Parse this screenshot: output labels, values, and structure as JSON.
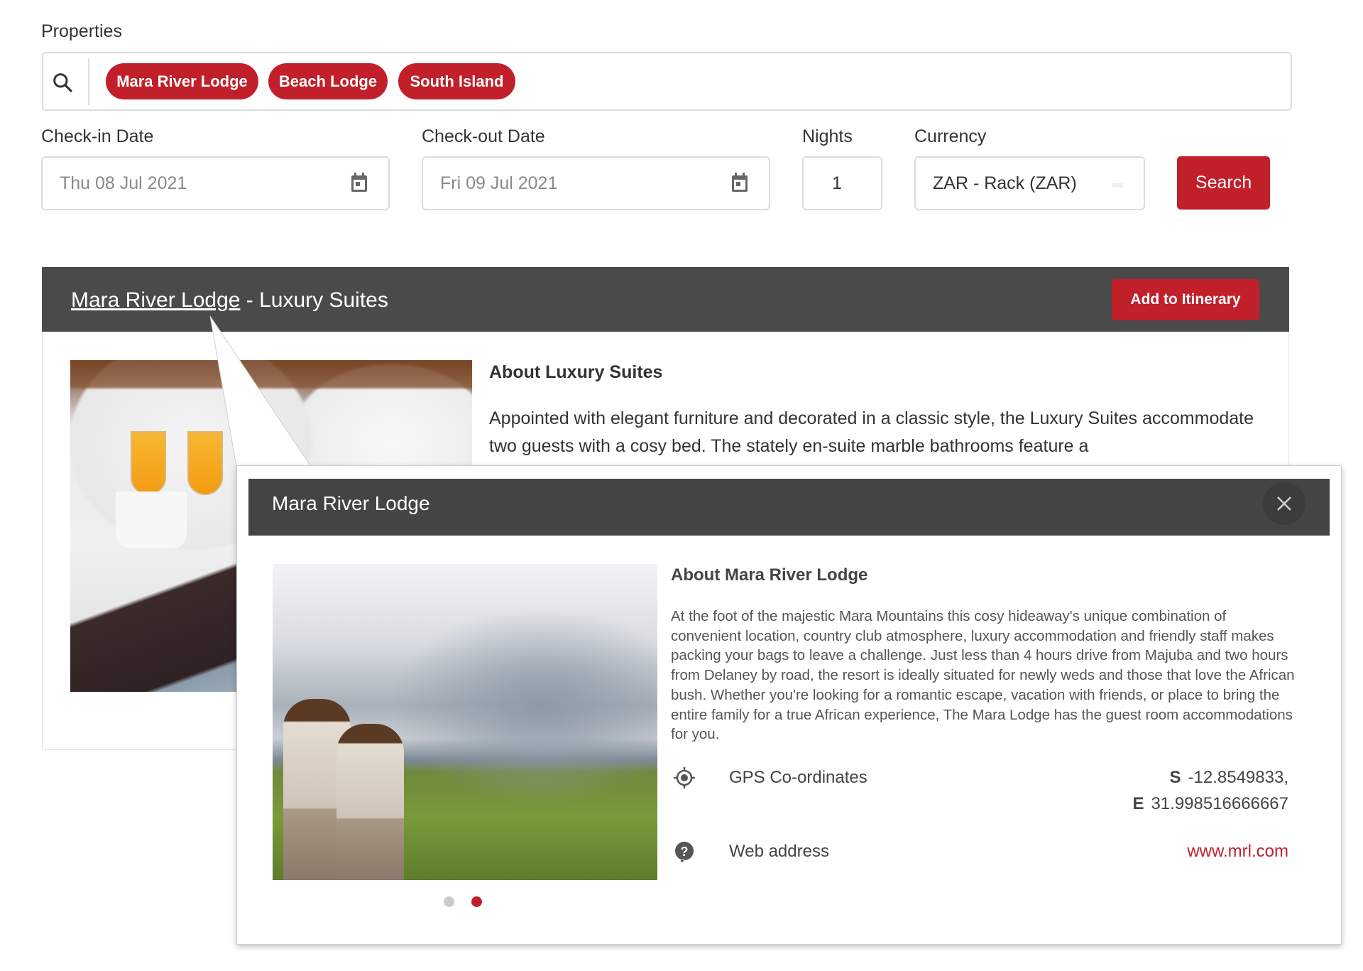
{
  "properties": {
    "label": "Properties",
    "search_icon": "search-icon",
    "chips": [
      {
        "label": "Mara River Lodge"
      },
      {
        "label": "Beach Lodge"
      },
      {
        "label": "South Island"
      }
    ]
  },
  "form": {
    "checkin": {
      "label": "Check-in Date",
      "value": "Thu 08 Jul 2021",
      "icon": "calendar-icon"
    },
    "checkout": {
      "label": "Check-out Date",
      "value": "Fri 09 Jul 2021",
      "icon": "calendar-icon"
    },
    "nights": {
      "label": "Nights",
      "value": "1"
    },
    "currency": {
      "label": "Currency",
      "value": "ZAR - Rack (ZAR)"
    },
    "search_button": "Search"
  },
  "room": {
    "property_link": "Mara River Lodge",
    "title_suffix": " - Luxury Suites",
    "add_button": "Add to Itinerary",
    "about_heading": "About Luxury Suites",
    "about_text": "Appointed with elegant furniture and decorated in a classic style, the Luxury Suites accommodate two guests with a cosy bed. The stately en-suite marble bathrooms feature a"
  },
  "popup": {
    "title": "Mara River Lodge",
    "close_icon": "close-icon",
    "about_heading": "About Mara River Lodge",
    "about_text": "At the foot of the majestic Mara Mountains this cosy hideaway's unique combination of convenient location, country club atmosphere, luxury accommodation and friendly staff makes packing your bags to leave a challenge. Just less than 4 hours drive from Majuba and two hours from Delaney by road, the resort is ideally situated for newly weds and those that love the African bush. Whether you're looking for a romantic escape, vacation with friends, or place to bring the entire family for a true African experience, The Mara Lodge has the guest room accommodations for you.",
    "gps": {
      "label": "GPS Co-ordinates",
      "icon": "gps-target-icon",
      "lat_prefix": "S",
      "lat": "-12.8549833,",
      "lng_prefix": "E",
      "lng": "31.998516666667"
    },
    "web": {
      "label": "Web address",
      "icon": "help-circle-icon",
      "url": "www.mrl.com"
    },
    "carousel": {
      "total": 2,
      "active_index": 2
    }
  },
  "colors": {
    "brand_red": "#c1202b",
    "header_dark": "#4a4a4a",
    "dot_inactive": "#cccccc"
  }
}
